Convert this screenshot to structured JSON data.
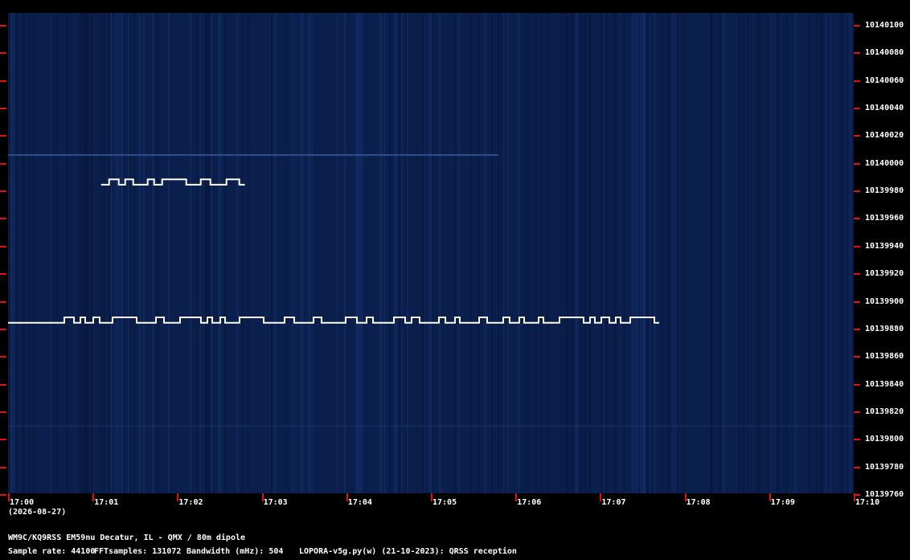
{
  "header": {
    "station": "WM9C/KQ9RSS EM59nu Decatur, IL - QMX / 80m dipole",
    "sample_rate": "Sample rate: 44100",
    "fft_samples": "FFTsamples: 131072",
    "bandwidth": "Bandwidth (mHz): 504",
    "software": "LOPORA-v5g.py(w) (21-10-2023): QRSS reception"
  },
  "date_label": "(2026-08-27)",
  "y_axis_labels": [
    "10140100",
    "10140080",
    "10140060",
    "10140040",
    "10140020",
    "10140000",
    "10139980",
    "10139960",
    "10139940",
    "10139920",
    "10139900",
    "10139880",
    "10139860",
    "10139840",
    "10139820",
    "10139800",
    "10139780",
    "10139760"
  ],
  "x_axis_labels": [
    "17:00",
    "17:01",
    "17:02",
    "17:03",
    "17:04",
    "17:05",
    "17:06",
    "17:07",
    "17:08",
    "17:09",
    "17:10"
  ],
  "colors": {
    "background": "#0b1f4c",
    "signal": "#ffffff",
    "tick": "#e01010"
  },
  "chart_data": {
    "type": "spectrogram",
    "x_range": [
      "17:00",
      "17:10"
    ],
    "y_range": [
      10139750,
      10140105
    ],
    "signals": [
      {
        "description_visible": false,
        "start": "17:00",
        "end": "17:07.7",
        "base_freq": 10139876,
        "shift_freq": 10139880
      },
      {
        "description_visible": false,
        "start": "17:01.1",
        "end": "17:02.8",
        "base_freq": 10139978,
        "shift_freq": 10139982
      }
    ]
  }
}
